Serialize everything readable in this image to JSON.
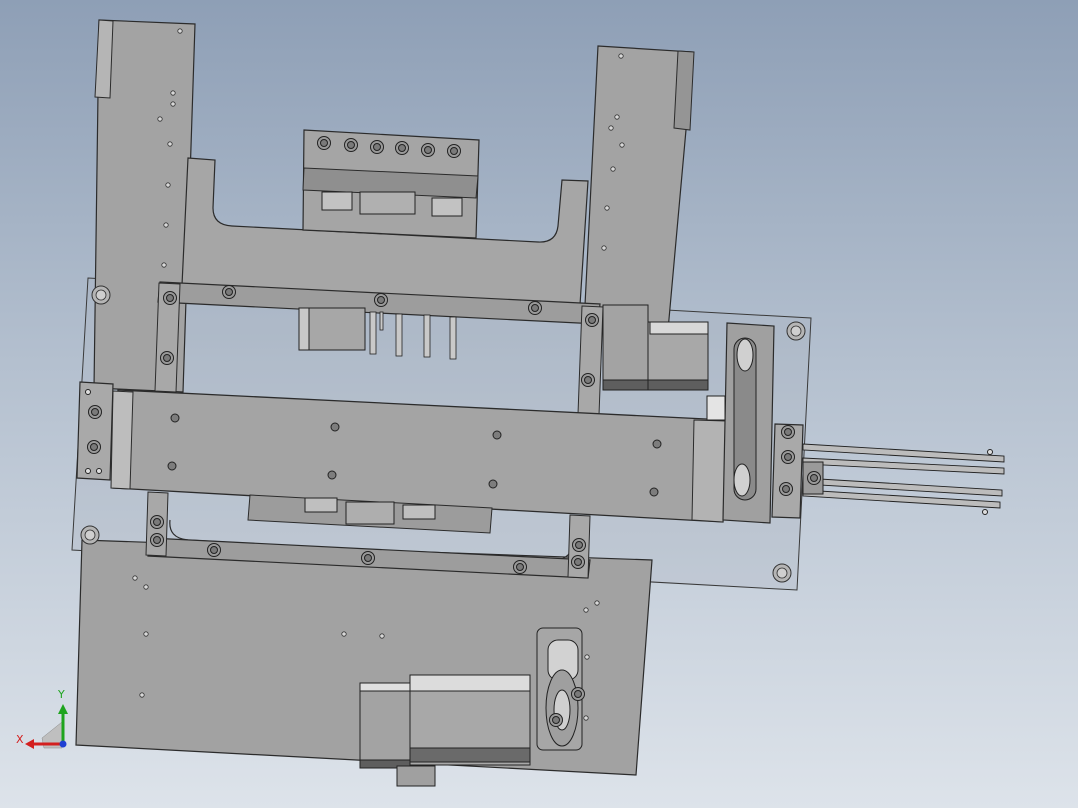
{
  "viewport": {
    "background_top": "#8e9fb6",
    "background_bottom": "#dde3ea",
    "part_fill": "#a3a3a3",
    "part_fill_dark": "#8a8a8a",
    "part_fill_light": "#c4c4c4",
    "edge_color": "#2b2b2b"
  },
  "triad": {
    "x_label": "X",
    "y_label": "Y",
    "x_color": "#d31f1f",
    "y_color": "#1ea41e",
    "z_color": "#1f3fd3"
  }
}
